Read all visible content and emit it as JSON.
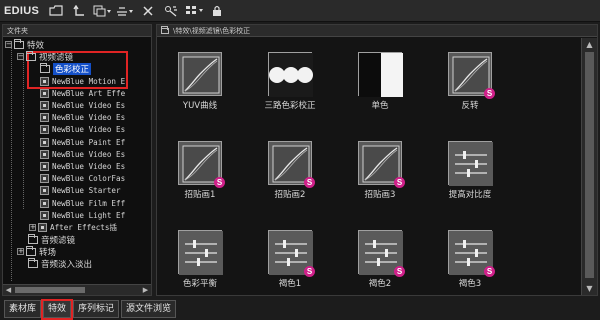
{
  "app": {
    "name": "EDIUS"
  },
  "toolbar": {
    "buttons": [
      {
        "icon": "folder-icon"
      },
      {
        "icon": "up-level-icon"
      },
      {
        "icon": "view-mode-icon"
      },
      {
        "icon": "align-icon"
      },
      {
        "icon": "delete-icon"
      },
      {
        "icon": "properties-icon"
      },
      {
        "icon": "list-view-icon"
      },
      {
        "icon": "lock-icon"
      }
    ]
  },
  "left_panel": {
    "header": "文件夹",
    "tree": [
      {
        "label": "特效",
        "level": 0,
        "expander": "−",
        "folder": true
      },
      {
        "label": "视频滤镜",
        "level": 1,
        "expander": "−",
        "folder": true
      },
      {
        "label": "色彩校正",
        "level": 2,
        "folder": true,
        "selected": true
      },
      {
        "label": "NewBlue Motion E",
        "level": 2,
        "mono": true
      },
      {
        "label": "NewBlue Art Effe",
        "level": 2,
        "mono": true
      },
      {
        "label": "NewBlue Video Es",
        "level": 2,
        "mono": true
      },
      {
        "label": "NewBlue Video Es",
        "level": 2,
        "mono": true
      },
      {
        "label": "NewBlue Video Es",
        "level": 2,
        "mono": true
      },
      {
        "label": "NewBlue Paint Ef",
        "level": 2,
        "mono": true
      },
      {
        "label": "NewBlue Video Es",
        "level": 2,
        "mono": true
      },
      {
        "label": "NewBlue Video Es",
        "level": 2,
        "mono": true
      },
      {
        "label": "NewBlue ColorFas",
        "level": 2,
        "mono": true
      },
      {
        "label": "NewBlue Starter",
        "level": 2,
        "mono": true
      },
      {
        "label": "NewBlue Film Eff",
        "level": 2,
        "mono": true
      },
      {
        "label": "NewBlue Light Ef",
        "level": 2,
        "mono": true
      },
      {
        "label": "After Effects插",
        "level": 2,
        "mono": true,
        "expander": "+"
      },
      {
        "label": "音频滤镜",
        "level": 1,
        "folder": true
      },
      {
        "label": "转场",
        "level": 1,
        "expander": "+",
        "folder": true
      },
      {
        "label": "音频淡入淡出",
        "level": 1,
        "folder": true
      }
    ]
  },
  "right_panel": {
    "path": "\\特效\\视频滤镜\\色彩校正",
    "effects": [
      {
        "label": "YUV曲线",
        "thumb": "curve",
        "badge": false
      },
      {
        "label": "三路色彩校正",
        "thumb": "three-way",
        "badge": false
      },
      {
        "label": "单色",
        "thumb": "mono",
        "badge": false
      },
      {
        "label": "反转",
        "thumb": "curve",
        "badge": true
      },
      {
        "label": "招贴画1",
        "thumb": "curve",
        "badge": true
      },
      {
        "label": "招贴画2",
        "thumb": "curve",
        "badge": true
      },
      {
        "label": "招贴画3",
        "thumb": "curve",
        "badge": true
      },
      {
        "label": "提高对比度",
        "thumb": "sliders",
        "badge": false
      },
      {
        "label": "色彩平衡",
        "thumb": "sliders",
        "badge": false
      },
      {
        "label": "褐色1",
        "thumb": "sliders",
        "badge": true
      },
      {
        "label": "褐色2",
        "thumb": "sliders",
        "badge": true
      },
      {
        "label": "褐色3",
        "thumb": "sliders",
        "badge": true
      }
    ],
    "badge_letter": "S"
  },
  "bottom_tabs": [
    {
      "label": "素材库",
      "active": false
    },
    {
      "label": "特效",
      "active": true
    },
    {
      "label": "序列标记",
      "active": false
    },
    {
      "label": "源文件浏览",
      "active": false
    }
  ],
  "colors": {
    "selection": "#1450c8",
    "highlight": "#e02424",
    "badge": "#d0208a"
  }
}
